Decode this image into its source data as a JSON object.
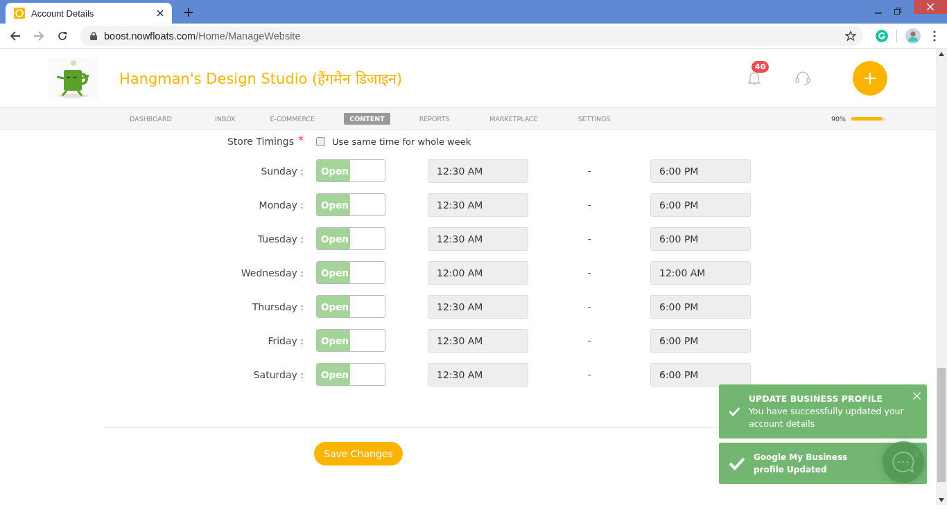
{
  "browser": {
    "tab_title": "Account Details",
    "url_host": "boost.nowfloats.com",
    "url_path": "/Home/ManageWebsite"
  },
  "header": {
    "business_name": "Hangman's Design Studio (हैंगमैन डिजाइन)",
    "notification_count": "40"
  },
  "nav": [
    {
      "label": "DASHBOARD",
      "selected": false
    },
    {
      "label": "INBOX",
      "selected": false
    },
    {
      "label": "E-COMMERCE",
      "selected": false
    },
    {
      "label": "CONTENT",
      "selected": true
    },
    {
      "label": "REPORTS",
      "selected": false
    },
    {
      "label": "MARKETPLACE",
      "selected": false
    },
    {
      "label": "SETTINGS",
      "selected": false
    }
  ],
  "completion": {
    "reading": "90%",
    "level": 0.9
  },
  "store_timings": {
    "label": "Store Timings",
    "required_mark": "*",
    "same_time": {
      "label": "Use same time for whole week",
      "checked": false
    },
    "days": [
      {
        "day": "Sunday :",
        "status": "Open",
        "open": true,
        "from": "12:30 AM",
        "separator": "-",
        "to": "6:00 PM"
      },
      {
        "day": "Monday :",
        "status": "Open",
        "open": true,
        "from": "12:30 AM",
        "separator": "-",
        "to": "6:00 PM"
      },
      {
        "day": "Tuesday :",
        "status": "Open",
        "open": true,
        "from": "12:30 AM",
        "separator": "-",
        "to": "6:00 PM"
      },
      {
        "day": "Wednesday :",
        "status": "Open",
        "open": true,
        "from": "12:00 AM",
        "separator": "-",
        "to": "12:00 AM"
      },
      {
        "day": "Thursday :",
        "status": "Open",
        "open": true,
        "from": "12:30 AM",
        "separator": "-",
        "to": "6:00 PM"
      },
      {
        "day": "Friday :",
        "status": "Open",
        "open": true,
        "from": "12:30 AM",
        "separator": "-",
        "to": "6:00 PM"
      },
      {
        "day": "Saturday :",
        "status": "Open",
        "open": true,
        "from": "12:30 AM",
        "separator": "-",
        "to": "6:00 PM"
      }
    ]
  },
  "save_button": "Save Changes",
  "toasts": [
    {
      "title": "UPDATE BUSINESS PROFILE",
      "message": "You have successfully updated your account details"
    },
    {
      "title": "Google My Business profile Updated"
    }
  ]
}
